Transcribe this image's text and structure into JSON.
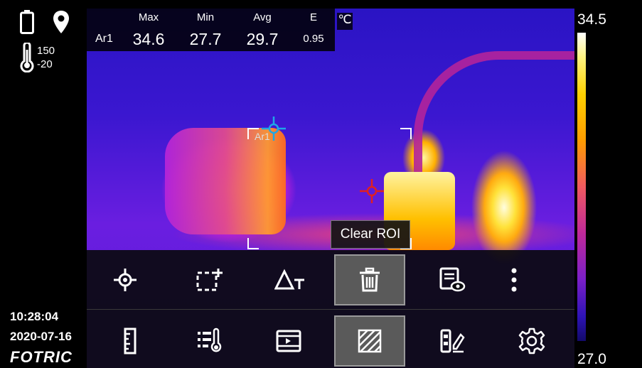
{
  "status": {
    "temp_range_max": "150",
    "temp_range_min": "-20",
    "time": "10:28:04",
    "date": "2020-07-16",
    "brand": "FOTRIC"
  },
  "measurement": {
    "headers": [
      "Max",
      "Min",
      "Avg",
      "E"
    ],
    "region": "Ar1",
    "max": "34.6",
    "min": "27.7",
    "avg": "29.7",
    "emissivity": "0.95",
    "unit": "℃"
  },
  "roi_label": "Ar1",
  "tooltip": "Clear ROI",
  "scale": {
    "max": "34.5",
    "min": "27.0"
  },
  "toolbar": {
    "row1": [
      "spot-measure",
      "add-area",
      "delta-t",
      "clear-roi",
      "view-report",
      "more"
    ],
    "row2": [
      "ruler",
      "temp-list",
      "video",
      "hatch-area",
      "palette-edit",
      "settings"
    ]
  },
  "colors": {
    "active_button": "#5a5a5a",
    "spot_blue": "#1fa6e6",
    "spot_red": "#e02020"
  }
}
